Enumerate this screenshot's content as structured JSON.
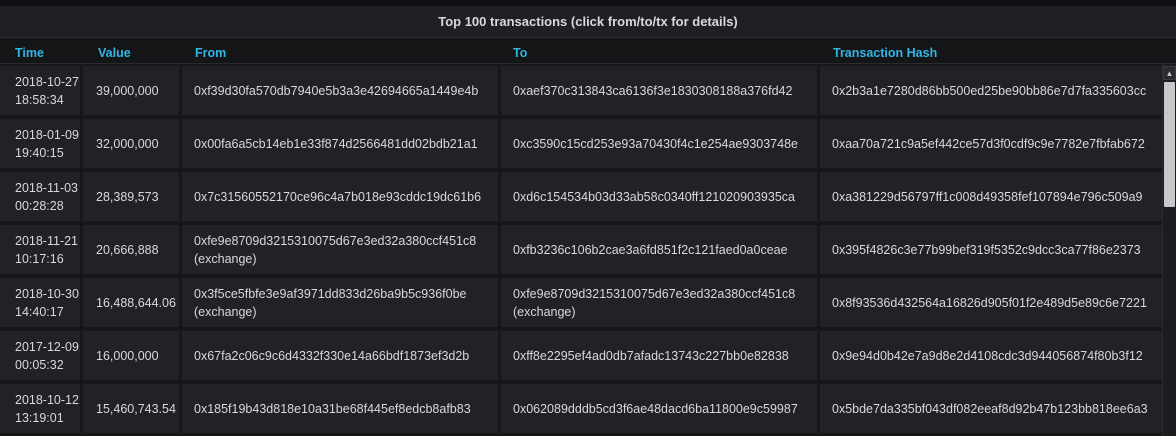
{
  "panel": {
    "title": "Top 100 transactions (click from/to/tx for details)"
  },
  "columns": {
    "time": "Time",
    "value": "Value",
    "from": "From",
    "to": "To",
    "hash": "Transaction Hash"
  },
  "rows": [
    {
      "date": "2018-10-27",
      "time": "18:58:34",
      "value": "39,000,000",
      "from": "0xf39d30fa570db7940e5b3a3e42694665a1449e4b",
      "from_note": "",
      "to": "0xaef370c313843ca6136f3e1830308188a376fd42",
      "to_note": "",
      "hash": "0x2b3a1e7280d86bb500ed25be90bb86e7d7fa335603cc"
    },
    {
      "date": "2018-01-09",
      "time": "19:40:15",
      "value": "32,000,000",
      "from": "0x00fa6a5cb14eb1e33f874d2566481dd02bdb21a1",
      "from_note": "",
      "to": "0xc3590c15cd253e93a70430f4c1e254ae9303748e",
      "to_note": "",
      "hash": "0xaa70a721c9a5ef442ce57d3f0cdf9c9e7782e7fbfab672"
    },
    {
      "date": "2018-11-03",
      "time": "00:28:28",
      "value": "28,389,573",
      "from": "0x7c31560552170ce96c4a7b018e93cddc19dc61b6",
      "from_note": "",
      "to": "0xd6c154534b03d33ab58c0340ff121020903935ca",
      "to_note": "",
      "hash": "0xa381229d56797ff1c008d49358fef107894e796c509a9"
    },
    {
      "date": "2018-11-21",
      "time": "10:17:16",
      "value": "20,666,888",
      "from": "0xfe9e8709d3215310075d67e3ed32a380ccf451c8",
      "from_note": "(exchange)",
      "to": "0xfb3236c106b2cae3a6fd851f2c121faed0a0ceae",
      "to_note": "",
      "hash": "0x395f4826c3e77b99bef319f5352c9dcc3ca77f86e2373"
    },
    {
      "date": "2018-10-30",
      "time": "14:40:17",
      "value": "16,488,644.06",
      "from": "0x3f5ce5fbfe3e9af3971dd833d26ba9b5c936f0be",
      "from_note": "(exchange)",
      "to": "0xfe9e8709d3215310075d67e3ed32a380ccf451c8",
      "to_note": "(exchange)",
      "hash": "0x8f93536d432564a16826d905f01f2e489d5e89c6e7221"
    },
    {
      "date": "2017-12-09",
      "time": "00:05:32",
      "value": "16,000,000",
      "from": "0x67fa2c06c9c6d4332f330e14a66bdf1873ef3d2b",
      "from_note": "",
      "to": "0xff8e2295ef4ad0db7afadc13743c227bb0e82838",
      "to_note": "",
      "hash": "0x9e94d0b42e7a9d8e2d4108cdc3d944056874f80b3f12"
    },
    {
      "date": "2018-10-12",
      "time": "13:19:01",
      "value": "15,460,743.54",
      "from": "0x185f19b43d818e10a31be68f445ef8edcb8afb83",
      "from_note": "",
      "to": "0x062089dddb5cd3f6ae48dacd6ba11800e9c59987",
      "to_note": "",
      "hash": "0x5bde7da335bf043df082eeaf8d92b47b123bb818ee6a3"
    }
  ],
  "scrollbar": {
    "up_icon": "triangle-up-icon",
    "thumb_color": "#c8c8c8"
  },
  "colors": {
    "header_text": "#33b5e5",
    "cell_bg": "#212226",
    "page_bg": "#161719",
    "text": "#d8d9da"
  }
}
